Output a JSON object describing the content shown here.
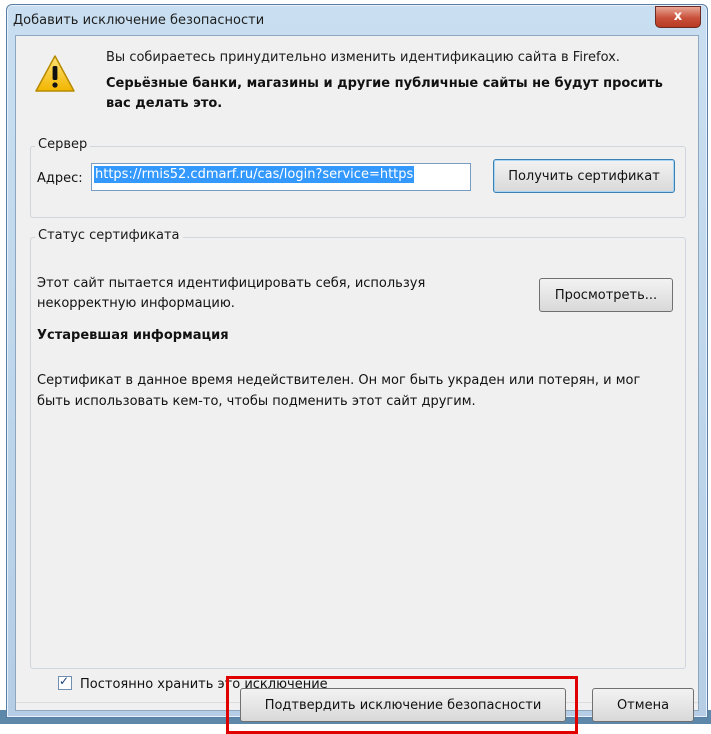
{
  "window": {
    "title": "Добавить исключение безопасности",
    "close_label": "x"
  },
  "warning": {
    "icon": "warning-icon",
    "line1": "Вы собираетесь принудительно изменить идентификацию сайта в Firefox.",
    "line2": "Серьёзные банки, магазины и другие публичные сайты не будут просить вас делать это."
  },
  "server": {
    "legend": "Сервер",
    "address_label": "Адрес:",
    "address_value": "https://rmis52.cdmarf.ru/cas/login?service=https",
    "get_cert_label": "Получить сертификат"
  },
  "status": {
    "legend": "Статус сертификата",
    "text1": "Этот сайт пытается идентифицировать себя, используя некорректную информацию.",
    "view_label": "Просмотреть...",
    "bold_label": "Устаревшая информация",
    "text2": "Сертификат в данное время недействителен. Он мог быть украден или потерян, и мог быть использовать кем-то, чтобы подменить этот сайт другим."
  },
  "permanent": {
    "label": "Постоянно хранить это исключение",
    "checked": true
  },
  "buttons": {
    "confirm_label": "Подтвердить исключение безопасности",
    "cancel_label": "Отмена"
  },
  "colors": {
    "highlight_box": "#e00000",
    "selection": "#3399ff"
  }
}
